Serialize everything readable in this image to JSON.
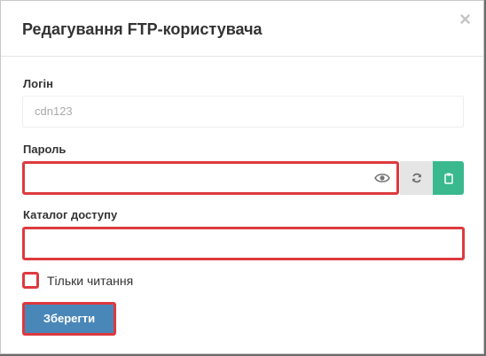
{
  "dialog": {
    "title": "Редагування FTP-користувача",
    "close_symbol": "×"
  },
  "login": {
    "label": "Логін",
    "value": "cdn123"
  },
  "password": {
    "label": "Пароль",
    "value": "",
    "show_icon": "eye-icon",
    "regenerate_icon": "refresh-icon",
    "copy_icon": "clipboard-icon"
  },
  "directory": {
    "label": "Каталог доступу",
    "value": ""
  },
  "readonly": {
    "label": "Тільки читання",
    "checked": false
  },
  "actions": {
    "save_label": "Зберегти"
  },
  "colors": {
    "highlight": "#dd3a3f",
    "primary": "#4a87b9",
    "success": "#3ab98e"
  }
}
